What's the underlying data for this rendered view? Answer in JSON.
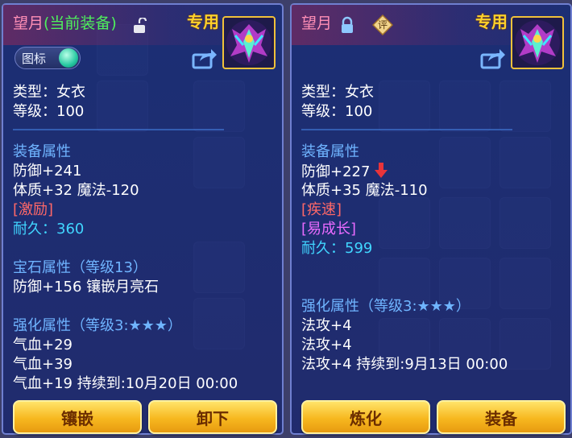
{
  "left": {
    "title": "望月",
    "title_sub": "(当前装备)",
    "tag": "专用",
    "toggle_label": "图标",
    "lines": [
      {
        "text": "类型：女衣"
      },
      {
        "text": "等级：100"
      },
      {
        "text": "装备属性"
      },
      {
        "text": "防御+241"
      },
      {
        "text": "体质+32 魔法-120"
      },
      {
        "text": "[激励]"
      },
      {
        "text": "耐久：360"
      },
      {
        "text": "宝石属性（等级13）"
      },
      {
        "text": "防御+156 镶嵌月亮石"
      },
      {
        "text": "强化属性（等级3:★★★）"
      },
      {
        "text": "气血+29"
      },
      {
        "text": "气血+39"
      },
      {
        "text": "气血+19   持续到:10月20日 00:00"
      }
    ],
    "buttons": [
      "镶嵌",
      "卸下"
    ]
  },
  "right": {
    "title": "望月",
    "badge": "评",
    "tag": "专用",
    "lines": [
      {
        "text": "类型：女衣"
      },
      {
        "text": "等级：100"
      },
      {
        "text": "装备属性"
      },
      {
        "text": "防御+227"
      },
      {
        "text": "体质+35 魔法-110"
      },
      {
        "text": "[疾速]"
      },
      {
        "text": "[易成长]"
      },
      {
        "text": "耐久：599"
      },
      {
        "text": "强化属性（等级3:★★★）"
      },
      {
        "text": "法攻+4"
      },
      {
        "text": "法攻+4"
      },
      {
        "text": "法攻+4     持续到:9月13日 00:00"
      }
    ],
    "buttons": [
      "炼化",
      "装备"
    ]
  },
  "colors": {
    "title": "#ff8fb6",
    "current_equip": "#4ef05c",
    "section": "#6fb4ff",
    "effect": "#ff6868",
    "durability": "#41d6ff",
    "growth": "#e96bff",
    "button": "#f7b81f",
    "decrease_arrow": "#e8343a"
  },
  "icons": {
    "lock": "padlock-icon",
    "unlock": "unlocked-padlock-icon",
    "share": "share-icon",
    "down_arrow": "down-arrow-icon",
    "item": "robe-item-icon"
  }
}
